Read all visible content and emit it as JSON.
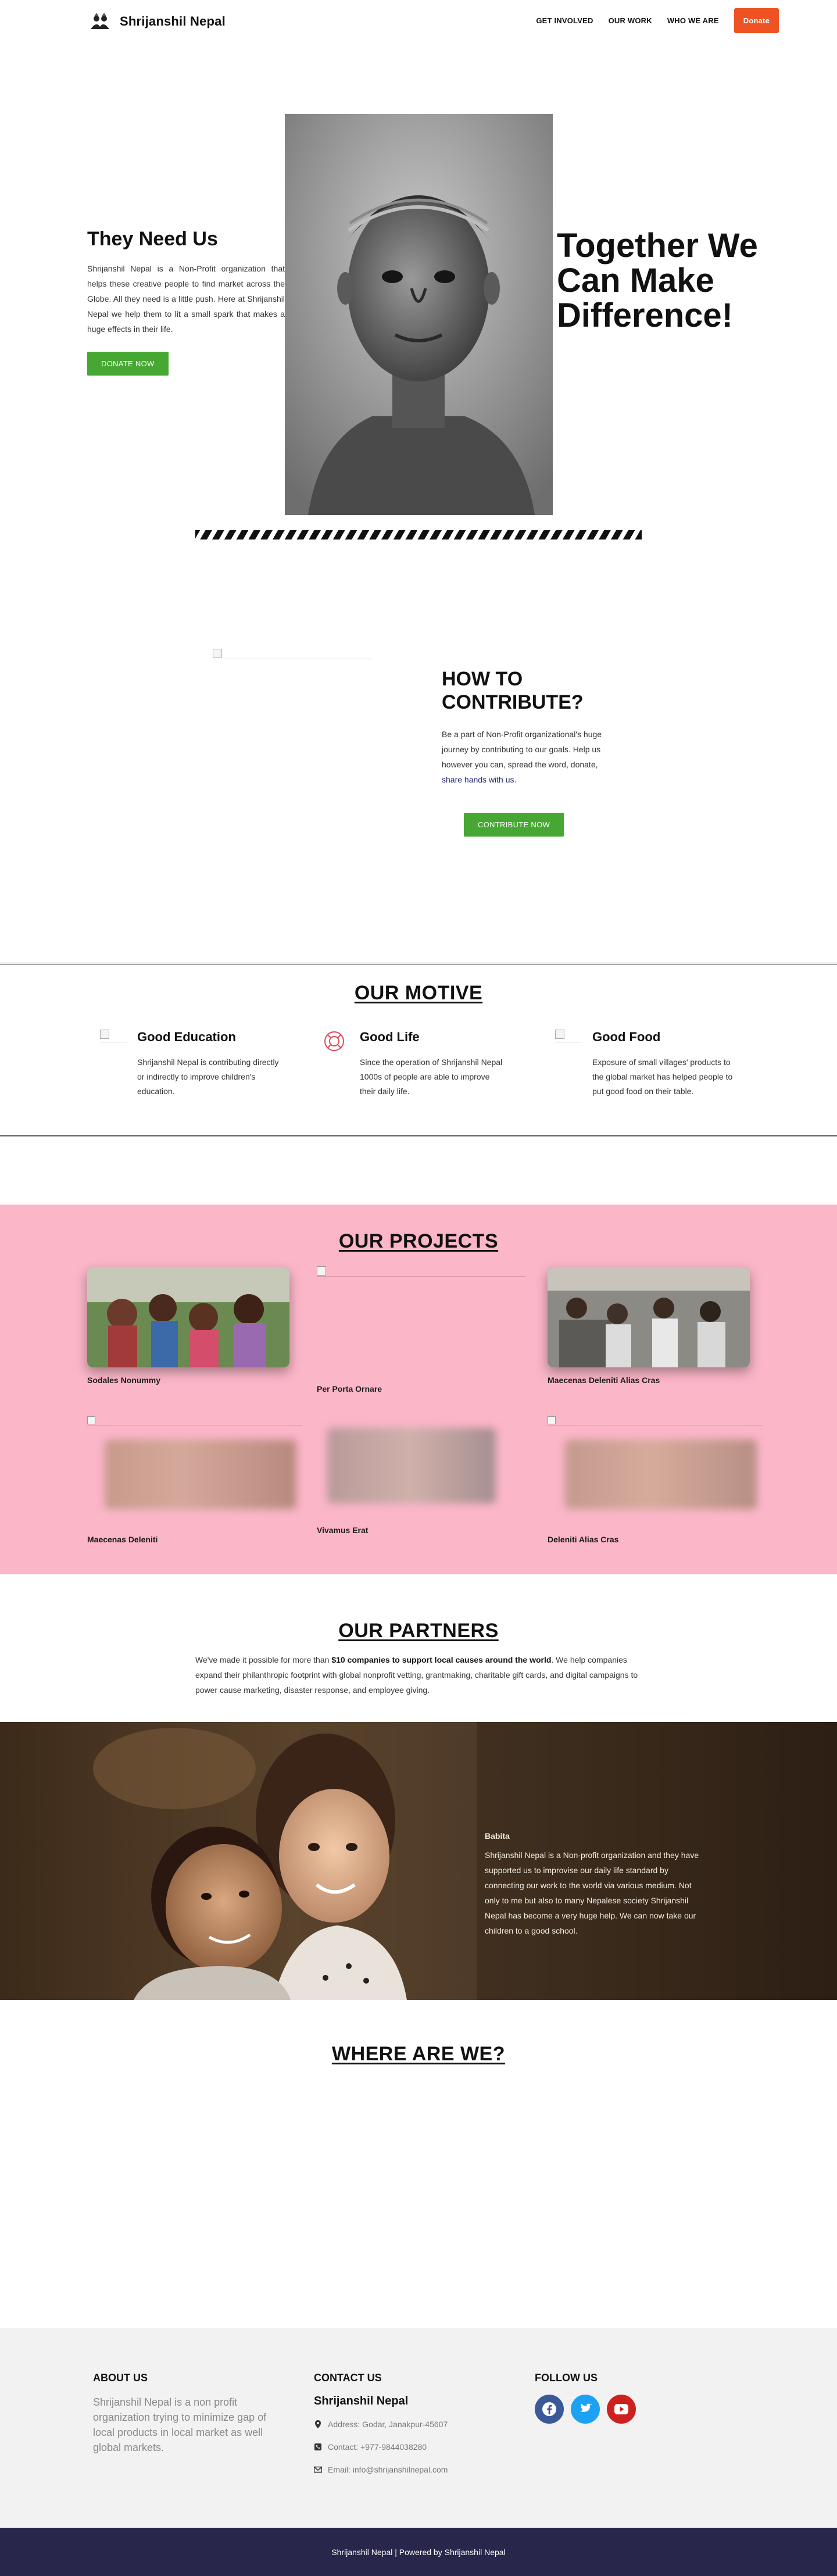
{
  "header": {
    "brand": "Shrijanshil Nepal",
    "nav": [
      "GET INVOLVED",
      "OUR WORK",
      "WHO WE ARE"
    ],
    "donate_label": "Donate"
  },
  "hero": {
    "heading": "They Need Us",
    "text": "Shrijanshil Nepal is a Non-Profit organization that helps these creative people to find market across the Globe. All they need is a little push. Here at Shrijanshil Nepal we help them to lit a small spark that makes a huge effects in their life.",
    "button_label": "DONATE NOW",
    "tagline": "Together We Can Make Difference!"
  },
  "contribute": {
    "heading": "HOW TO CONTRIBUTE?",
    "text_main": "Be a part of Non-Profit organizational's huge journey by contributing to our goals. Help us however you can, spread the word, donate, ",
    "text_link": "share hands with us.",
    "button_label": "CONTRIBUTE NOW"
  },
  "motive": {
    "title": "OUR MOTIVE",
    "cards": [
      {
        "title": "Good Education",
        "text": "Shrijanshil Nepal is contributing directly or indirectly to improve children's education.",
        "icon": "broken-image-icon"
      },
      {
        "title": "Good Life",
        "text": "Since the operation of Shrijanshil Nepal 1000s of people are able to improve their daily life.",
        "icon": "life-ring-icon"
      },
      {
        "title": "Good Food",
        "text": "Exposure of small villages' products to the global market has helped people to put good food on their table.",
        "icon": "broken-image-icon"
      }
    ]
  },
  "projects": {
    "title": "OUR PROJECTS",
    "items": [
      "Sodales Nonummy",
      "Per Porta Ornare",
      "Maecenas Deleniti Alias Cras",
      "Maecenas Deleniti",
      "Vivamus Erat",
      "Deleniti Alias Cras"
    ]
  },
  "partners": {
    "title": "OUR PARTNERS",
    "text_before": "We've made it possible for more than ",
    "text_bold": "$10 companies to support local causes around the world",
    "text_after": ". We help companies expand their philanthropic footprint with global nonprofit vetting, grantmaking, charitable gift cards, and digital campaigns to power cause marketing, disaster response, and employee giving."
  },
  "testimonial": {
    "name": "Babita",
    "text": "Shrijanshil Nepal is a Non-profit organization and they have supported us to improvise our daily life standard by connecting our work to the world via various medium. Not only to me but also to many Nepalese society Shrijanshil Nepal has become a very huge help. We can now take our children to a good school."
  },
  "where": {
    "title": "WHERE ARE WE?"
  },
  "footer": {
    "about_title": "ABOUT US",
    "about_text": "Shrijanshil Nepal is a non profit organization trying to minimize gap of local products in local market as well global markets.",
    "contact_title": "CONTACT US",
    "contact_org": "Shrijanshil Nepal",
    "address": "Address: Godar, Janakpur-45607",
    "phone": "Contact: +977-9844038280",
    "email": "Email: info@shrijanshilnepal.com",
    "follow_title": "FOLLOW US",
    "social": [
      "facebook-icon",
      "twitter-icon",
      "youtube-icon"
    ],
    "copyright": "Shrijanshil Nepal | Powered by Shrijanshil Nepal"
  },
  "colors": {
    "donate": "#f05323",
    "green_button": "#46a832",
    "projects_bg": "#fbb6c8",
    "footer_bg": "#f2f2f2",
    "bottom_bar": "#28264a",
    "facebook": "#3b5998",
    "twitter": "#1da1f2",
    "youtube": "#cd201f"
  }
}
